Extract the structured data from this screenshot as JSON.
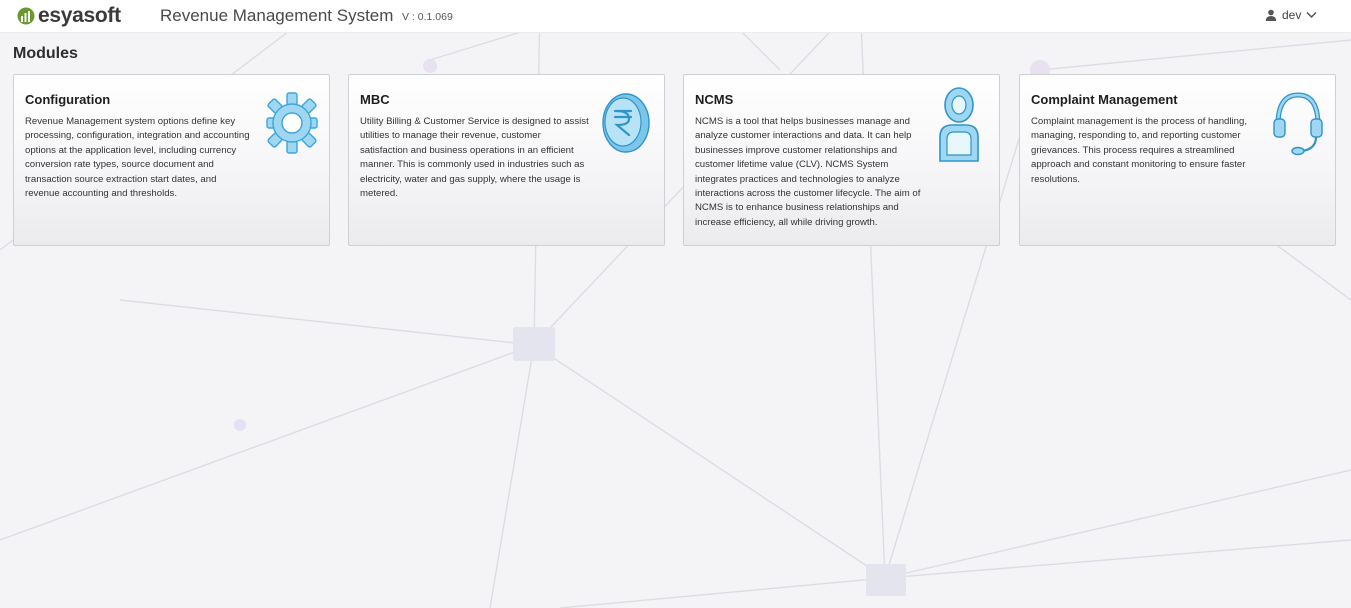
{
  "header": {
    "logo_text": "esyasoft",
    "app_title": "Revenue Management System",
    "version": "V : 0.1.069",
    "user": {
      "name": "dev",
      "icon": "user-icon",
      "menu_icon": "chevron-down-icon"
    }
  },
  "page": {
    "title": "Modules"
  },
  "modules": [
    {
      "title": "Configuration",
      "icon": "gear-icon",
      "description_lines": [
        "Revenue Management system options define key",
        "processing, configuration, integration and accounting",
        "options at the application level, including currency",
        "conversion rate types, source document and",
        "transaction source extraction start dates, and",
        "revenue accounting and thresholds."
      ]
    },
    {
      "title": "MBC",
      "icon": "rupee-coin-icon",
      "description_lines": [
        "Utility Billing & Customer Service is designed to assist",
        "utilities to manage their revenue, customer",
        "satisfaction and business operations in an efficient",
        "manner. This is commonly used in industries such as",
        "electricity, water and gas supply, where the usage is",
        "metered."
      ]
    },
    {
      "title": "NCMS",
      "icon": "person-icon",
      "description_lines": [
        "NCMS is a tool that helps businesses manage and",
        "analyze customer interactions and data. It can help",
        "businesses improve customer relationships and",
        "customer lifetime value (CLV). NCMS System",
        "integrates practices and technologies to analyze",
        "interactions across the customer lifecycle. The aim of",
        "NCMS is to enhance business relationships and",
        "increase efficiency, all while driving growth."
      ]
    },
    {
      "title": "Complaint Management",
      "icon": "headset-icon",
      "description_lines": [
        "Complaint management is the process of handling,",
        "managing, responding to, and reporting customer",
        "grievances. This process requires a streamlined",
        "approach and constant monitoring to ensure faster",
        "resolutions."
      ]
    }
  ],
  "colors": {
    "accent_blue": "#3aa6dc",
    "logo_green": "#6a9a2f",
    "background": "#f4f4f6"
  }
}
